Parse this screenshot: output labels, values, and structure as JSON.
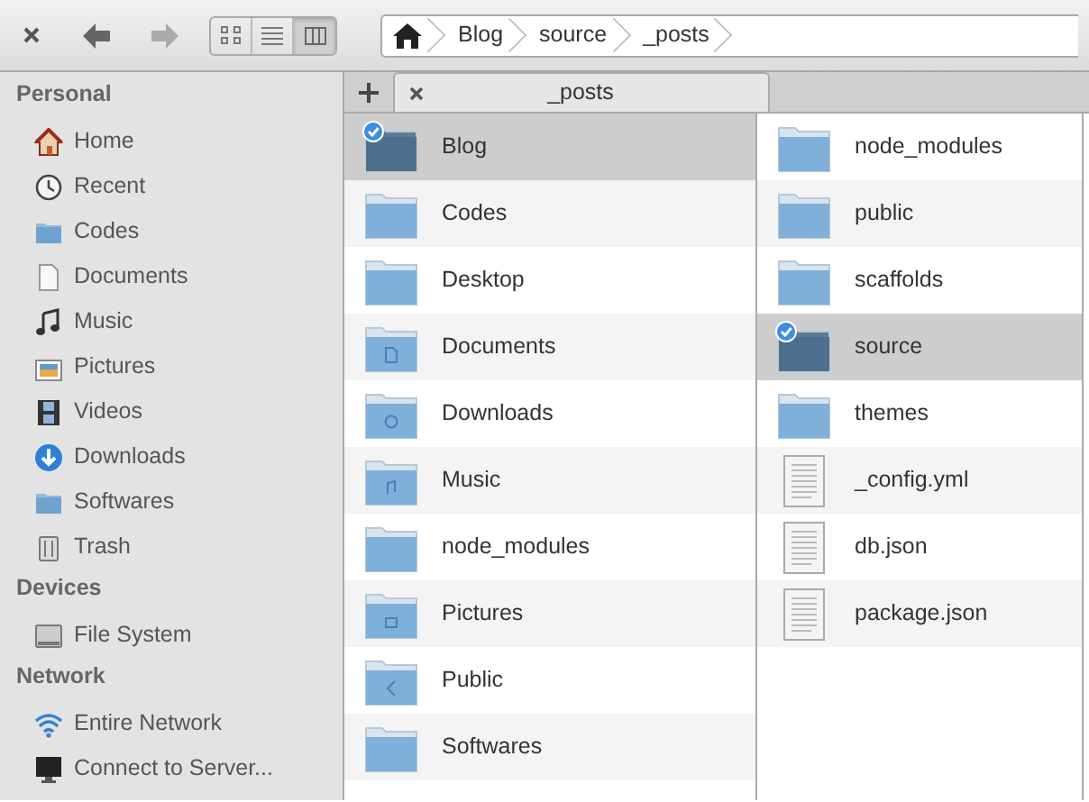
{
  "toolbar": {
    "back_enabled": true,
    "forward_enabled": false,
    "view_modes": [
      {
        "kind": "icons",
        "selected": false
      },
      {
        "kind": "list",
        "selected": false
      },
      {
        "kind": "columns",
        "selected": true
      }
    ],
    "breadcrumb": [
      "Blog",
      "source",
      "_posts"
    ]
  },
  "sidebar": {
    "sections": [
      {
        "title": "Personal",
        "items": [
          {
            "label": "Home",
            "kind": "home"
          },
          {
            "label": "Recent",
            "kind": "recent"
          },
          {
            "label": "Codes",
            "kind": "folder"
          },
          {
            "label": "Documents",
            "kind": "document"
          },
          {
            "label": "Music",
            "kind": "music"
          },
          {
            "label": "Pictures",
            "kind": "pictures"
          },
          {
            "label": "Videos",
            "kind": "videos"
          },
          {
            "label": "Downloads",
            "kind": "downloads"
          },
          {
            "label": "Softwares",
            "kind": "folder"
          },
          {
            "label": "Trash",
            "kind": "trash"
          }
        ]
      },
      {
        "title": "Devices",
        "items": [
          {
            "label": "File System",
            "kind": "drive"
          }
        ]
      },
      {
        "title": "Network",
        "items": [
          {
            "label": "Entire Network",
            "kind": "network"
          },
          {
            "label": "Connect to Server...",
            "kind": "monitor"
          }
        ]
      }
    ]
  },
  "tabs": [
    {
      "label": "_posts",
      "selected": true
    }
  ],
  "columns": [
    {
      "rows": [
        {
          "name": "Blog",
          "kind": "folder",
          "selected": true
        },
        {
          "name": "Codes",
          "kind": "folder",
          "selected": false
        },
        {
          "name": "Desktop",
          "kind": "folder",
          "selected": false
        },
        {
          "name": "Documents",
          "kind": "documents",
          "selected": false
        },
        {
          "name": "Downloads",
          "kind": "downloads",
          "selected": false
        },
        {
          "name": "Music",
          "kind": "music",
          "selected": false
        },
        {
          "name": "node_modules",
          "kind": "folder",
          "selected": false
        },
        {
          "name": "Pictures",
          "kind": "pictures",
          "selected": false
        },
        {
          "name": "Public",
          "kind": "public",
          "selected": false
        },
        {
          "name": "Softwares",
          "kind": "folder",
          "selected": false
        }
      ]
    },
    {
      "rows": [
        {
          "name": "node_modules",
          "kind": "folder",
          "selected": false
        },
        {
          "name": "public",
          "kind": "folder",
          "selected": false
        },
        {
          "name": "scaffolds",
          "kind": "folder",
          "selected": false
        },
        {
          "name": "source",
          "kind": "folder",
          "selected": true
        },
        {
          "name": "themes",
          "kind": "folder",
          "selected": false
        },
        {
          "name": "_config.yml",
          "kind": "file",
          "selected": false
        },
        {
          "name": "db.json",
          "kind": "file",
          "selected": false
        },
        {
          "name": "package.json",
          "kind": "file",
          "selected": false
        }
      ]
    }
  ]
}
